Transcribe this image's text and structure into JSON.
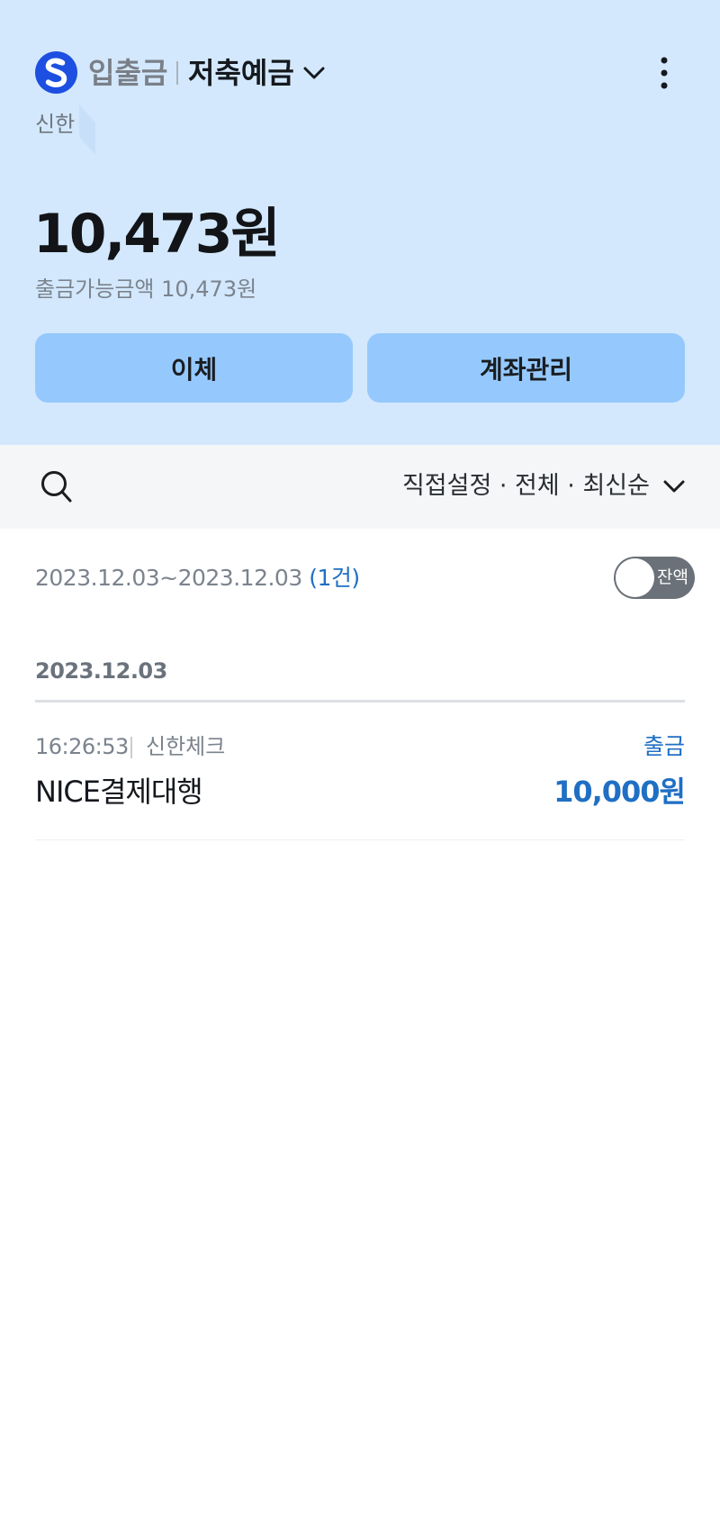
{
  "header": {
    "account_category": "입출금",
    "account_name": "저축예금",
    "bank_name": "신한",
    "balance": "10,473원",
    "available_balance": "출금가능금액 10,473원",
    "colors": {
      "background": "#d3e8fd",
      "button": "#95c9fe",
      "brand": "#1d4fe0"
    },
    "icons": {
      "logo": "shinhan-logo",
      "account_menu": "chevron-down-icon",
      "more": "more-vertical-icon"
    }
  },
  "actions": {
    "transfer_label": "이체",
    "manage_label": "계좌관리"
  },
  "filter": {
    "label": "직접설정 · 전체 · 최신순",
    "icons": {
      "search": "search-icon",
      "expand": "chevron-down-icon"
    }
  },
  "summary": {
    "range": "2023.12.03~2023.12.03",
    "count": "(1건)",
    "balance_toggle_label": "잔액",
    "balance_toggle_on": false
  },
  "transactions": {
    "groups": [
      {
        "date": "2023.12.03",
        "items": [
          {
            "time": "16:26:53",
            "card": "신한체크",
            "merchant": "NICE결제대행",
            "type": "출금",
            "amount": "10,000원"
          }
        ]
      }
    ],
    "accent_color": "#1f6fc4"
  }
}
